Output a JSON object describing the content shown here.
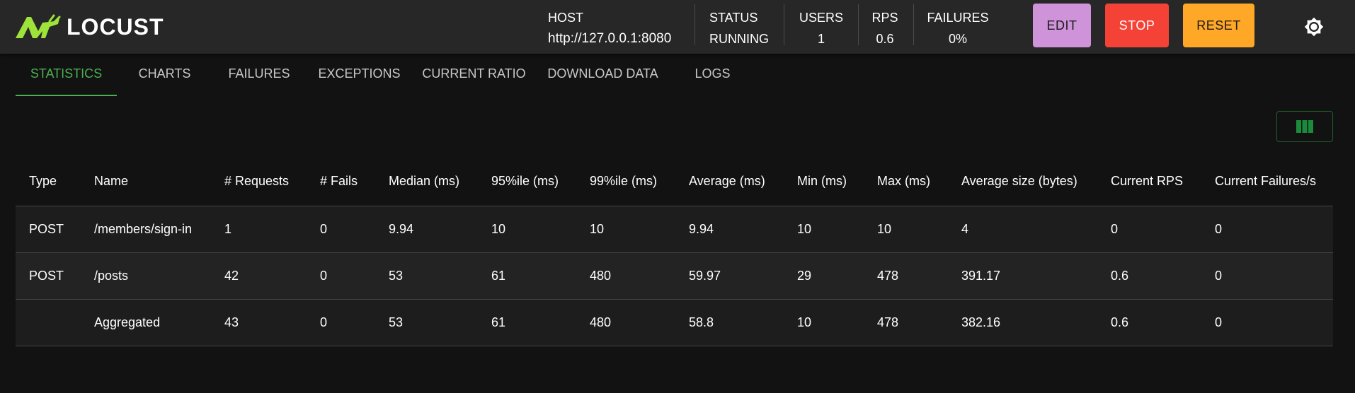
{
  "app": {
    "name": "LOCUST"
  },
  "header": {
    "host_label": "HOST",
    "host_value": "http://127.0.0.1:8080",
    "status_label": "STATUS",
    "status_value": "RUNNING",
    "users_label": "USERS",
    "users_value": "1",
    "rps_label": "RPS",
    "rps_value": "0.6",
    "failures_label": "FAILURES",
    "failures_value": "0%",
    "edit_label": "EDIT",
    "stop_label": "STOP",
    "reset_label": "RESET",
    "theme_icon": "brightness-icon"
  },
  "tabs": [
    {
      "label": "STATISTICS",
      "active": true
    },
    {
      "label": "CHARTS"
    },
    {
      "label": "FAILURES"
    },
    {
      "label": "EXCEPTIONS"
    },
    {
      "label": "CURRENT RATIO"
    },
    {
      "label": "DOWNLOAD DATA"
    },
    {
      "label": "LOGS"
    }
  ],
  "column_toggle_icon": "view-column-icon",
  "table": {
    "columns": [
      "Type",
      "Name",
      "# Requests",
      "# Fails",
      "Median (ms)",
      "95%ile (ms)",
      "99%ile (ms)",
      "Average (ms)",
      "Min (ms)",
      "Max (ms)",
      "Average size (bytes)",
      "Current RPS",
      "Current Failures/s"
    ],
    "rows": [
      [
        "POST",
        "/members/sign-in",
        "1",
        "0",
        "9.94",
        "10",
        "10",
        "9.94",
        "10",
        "10",
        "4",
        "0",
        "0"
      ],
      [
        "POST",
        "/posts",
        "42",
        "0",
        "53",
        "61",
        "480",
        "59.97",
        "29",
        "478",
        "391.17",
        "0.6",
        "0"
      ],
      [
        "",
        "Aggregated",
        "43",
        "0",
        "53",
        "61",
        "480",
        "58.8",
        "10",
        "478",
        "382.16",
        "0.6",
        "0"
      ]
    ]
  },
  "colors": {
    "background": "#121212",
    "appbar": "#272727",
    "accent_green": "#4caf50",
    "logo_green": "#9ee33a",
    "edit": "#ce93d8",
    "stop": "#f44336",
    "reset": "#ffa726"
  }
}
